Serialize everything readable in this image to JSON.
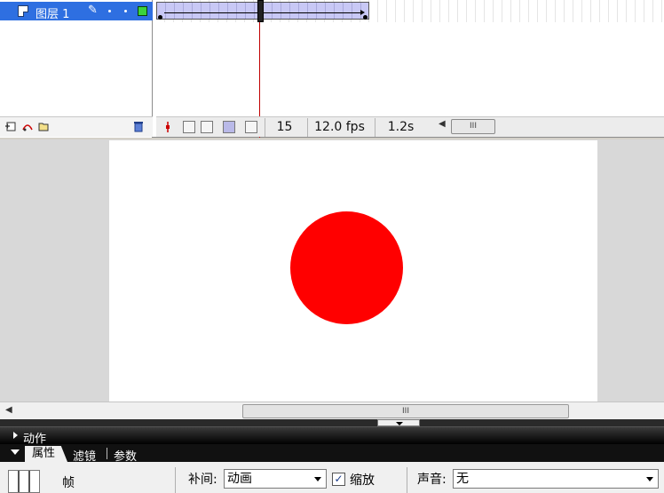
{
  "timeline": {
    "layer": {
      "name": "图层 1",
      "outline_color": "#3bd23b"
    },
    "current_frame": "15",
    "frame_rate": "12.0 fps",
    "elapsed_time": "1.2s",
    "scroll_thumb_label": "III"
  },
  "stage": {
    "background": "#ffffff",
    "shape": {
      "type": "circle",
      "fill": "#ff0000"
    },
    "scroll_thumb_label": "III"
  },
  "actions_panel": {
    "title": "动作"
  },
  "properties_panel": {
    "tabs": [
      "属性",
      "滤镜",
      "参数"
    ],
    "frame_label": "帧",
    "tween_label": "补间:",
    "tween_value": "动画",
    "scale_checked": true,
    "scale_label": "缩放",
    "sound_label": "声音:",
    "sound_value": "无"
  },
  "icons": {
    "pencil": "✎",
    "trash": "🗑",
    "checkmark": "✓"
  }
}
